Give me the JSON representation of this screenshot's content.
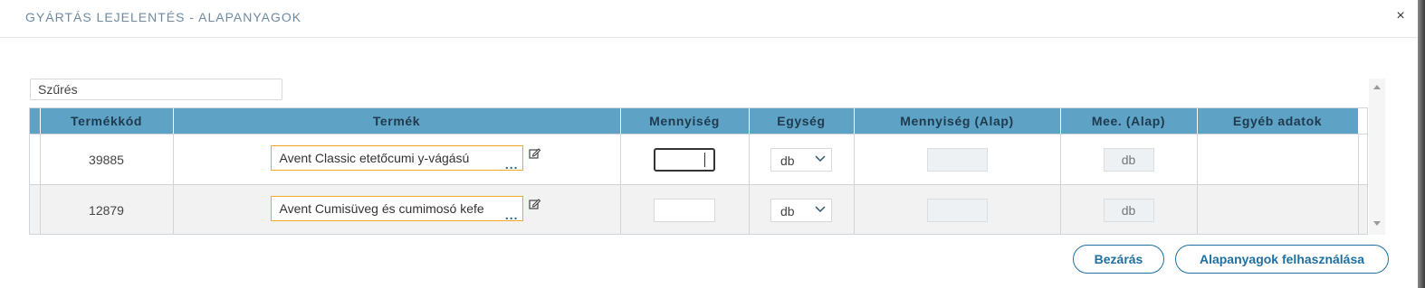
{
  "dialog": {
    "title": "GYÁRTÁS LEJELENTÉS - ALAPANYAGOK",
    "close_symbol": "×"
  },
  "filter": {
    "placeholder": "Szűrés",
    "value": ""
  },
  "table": {
    "columns": [
      "Termékkód",
      "Termék",
      "Mennyiség",
      "Egység",
      "Mennyiség (Alap)",
      "Mee. (Alap)",
      "Egyéb adatok"
    ],
    "rows": [
      {
        "code": "39885",
        "product": "Avent Classic etetőcumi y-vágású",
        "quantity": "",
        "unit": "db",
        "base_quantity": "",
        "base_unit": "db",
        "other": ""
      },
      {
        "code": "12879",
        "product": "Avent Cumisüveg és cumimosó kefe",
        "quantity": "",
        "unit": "db",
        "base_quantity": "",
        "base_unit": "db",
        "other": ""
      }
    ],
    "more_symbol": "..."
  },
  "buttons": {
    "close_label": "Bezárás",
    "use_label": "Alapanyagok felhasználása"
  },
  "colors": {
    "header_bg": "#5ea3c6",
    "accent": "#1f6fa0",
    "product_border": "#f5a623"
  },
  "icons": [
    "close-icon",
    "edit-icon",
    "chevron-down-icon",
    "scroll-up-icon",
    "scroll-down-icon"
  ]
}
